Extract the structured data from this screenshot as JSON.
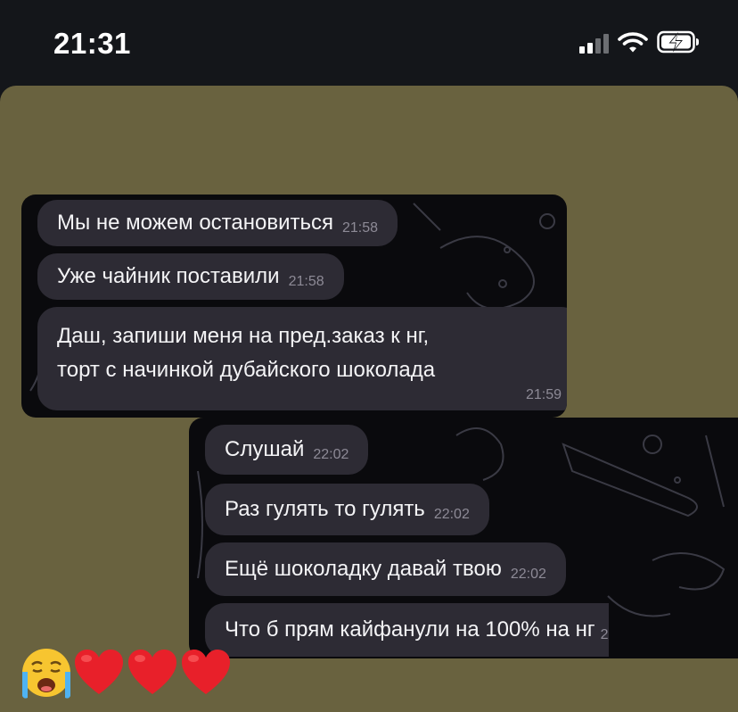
{
  "status_bar": {
    "time": "21:31",
    "icons": [
      "cellular-signal-icon",
      "wifi-icon",
      "battery-charging-icon"
    ]
  },
  "colors": {
    "card_background": "#69623f",
    "screenshot_background": "#0a0a0d",
    "bubble": "#2d2b34",
    "heart": "#e8202a",
    "emoji_face": "#f7c530"
  },
  "screenshot_top": {
    "messages": [
      {
        "text": "Мы не можем остановиться",
        "time": "21:58"
      },
      {
        "text": "Уже чайник поставили",
        "time": "21:58"
      },
      {
        "lines": [
          "Даш, запиши меня на пред.заказ к нг,",
          "торт с начинкой дубайского шоколада"
        ],
        "time": "21:59"
      }
    ]
  },
  "screenshot_bottom": {
    "messages": [
      {
        "text": "Слушай",
        "time": "22:02"
      },
      {
        "text": "Раз гулять то гулять",
        "time": "22:02"
      },
      {
        "text": "Ещё шоколадку давай твою",
        "time": "22:02"
      },
      {
        "text": "Что б прям кайфанули на 100% на нг",
        "time": "2"
      }
    ]
  },
  "reaction_emojis": [
    "loudly-crying-face-icon",
    "red-heart-icon",
    "red-heart-icon",
    "red-heart-icon"
  ]
}
